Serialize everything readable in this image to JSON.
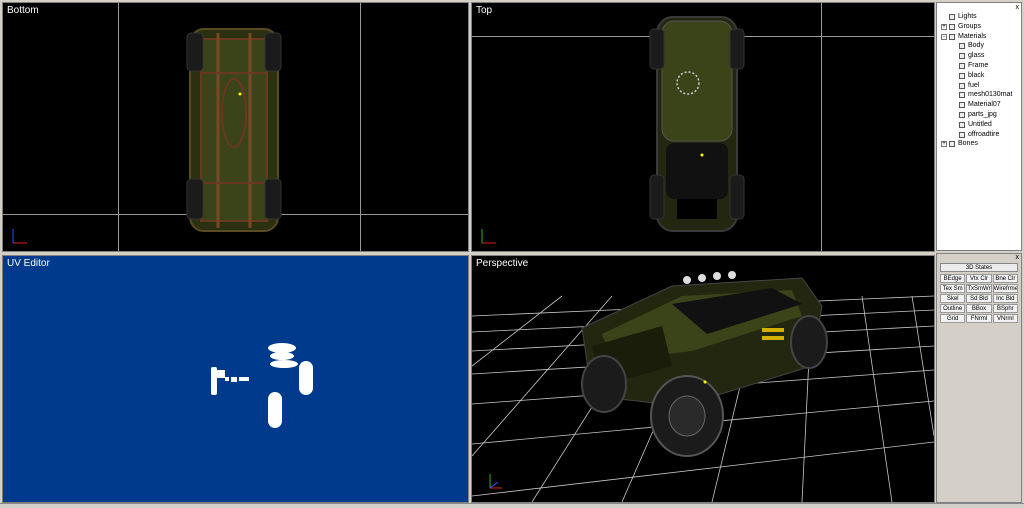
{
  "viewports": {
    "bottom": "Bottom",
    "top": "Top",
    "uv": "UV Editor",
    "perspective": "Perspective"
  },
  "tree": {
    "close": "x",
    "items": [
      {
        "label": "Lights",
        "level": 0,
        "expander": "",
        "icon": "light-icon"
      },
      {
        "label": "Groups",
        "level": 0,
        "expander": "+",
        "icon": "group-icon"
      },
      {
        "label": "Materials",
        "level": 0,
        "expander": "-",
        "icon": "material-icon"
      },
      {
        "label": "Body",
        "level": 1,
        "expander": "",
        "icon": "texture-icon"
      },
      {
        "label": "glass",
        "level": 1,
        "expander": "",
        "icon": "material-swatch-icon"
      },
      {
        "label": "Frame",
        "level": 1,
        "expander": "",
        "icon": "texture-icon"
      },
      {
        "label": "black",
        "level": 1,
        "expander": "",
        "icon": "material-swatch-icon"
      },
      {
        "label": "fuel",
        "level": 1,
        "expander": "",
        "icon": "material-swatch-icon"
      },
      {
        "label": "mesh0130mat",
        "level": 1,
        "expander": "",
        "icon": "texture-icon"
      },
      {
        "label": "Material07",
        "level": 1,
        "expander": "",
        "icon": "texture-icon"
      },
      {
        "label": "parts_jpg",
        "level": 1,
        "expander": "",
        "icon": "texture-icon"
      },
      {
        "label": "Untitled",
        "level": 1,
        "expander": "",
        "icon": "material-swatch-icon"
      },
      {
        "label": "offroadtire",
        "level": 1,
        "expander": "",
        "icon": "texture-icon"
      },
      {
        "label": "Bones",
        "level": 0,
        "expander": "+",
        "icon": "bone-icon"
      }
    ]
  },
  "states": {
    "close": "x",
    "title": "3D States",
    "buttons": [
      "BEdge",
      "Vtx Clr",
      "Bne Clr",
      "Tex Sm",
      "TxSmWr",
      "Wirefrme",
      "Skel",
      "Sd Bld",
      "Inc Bld",
      "Outline",
      "BBox",
      "BSphr",
      "Grid",
      "FNrml",
      "VNrml"
    ]
  },
  "colors": {
    "uv_background": "#003a8c",
    "car_body": "#3b4318",
    "axis_x": "#e02020",
    "axis_y": "#20c020",
    "axis_z": "#3050ff"
  }
}
